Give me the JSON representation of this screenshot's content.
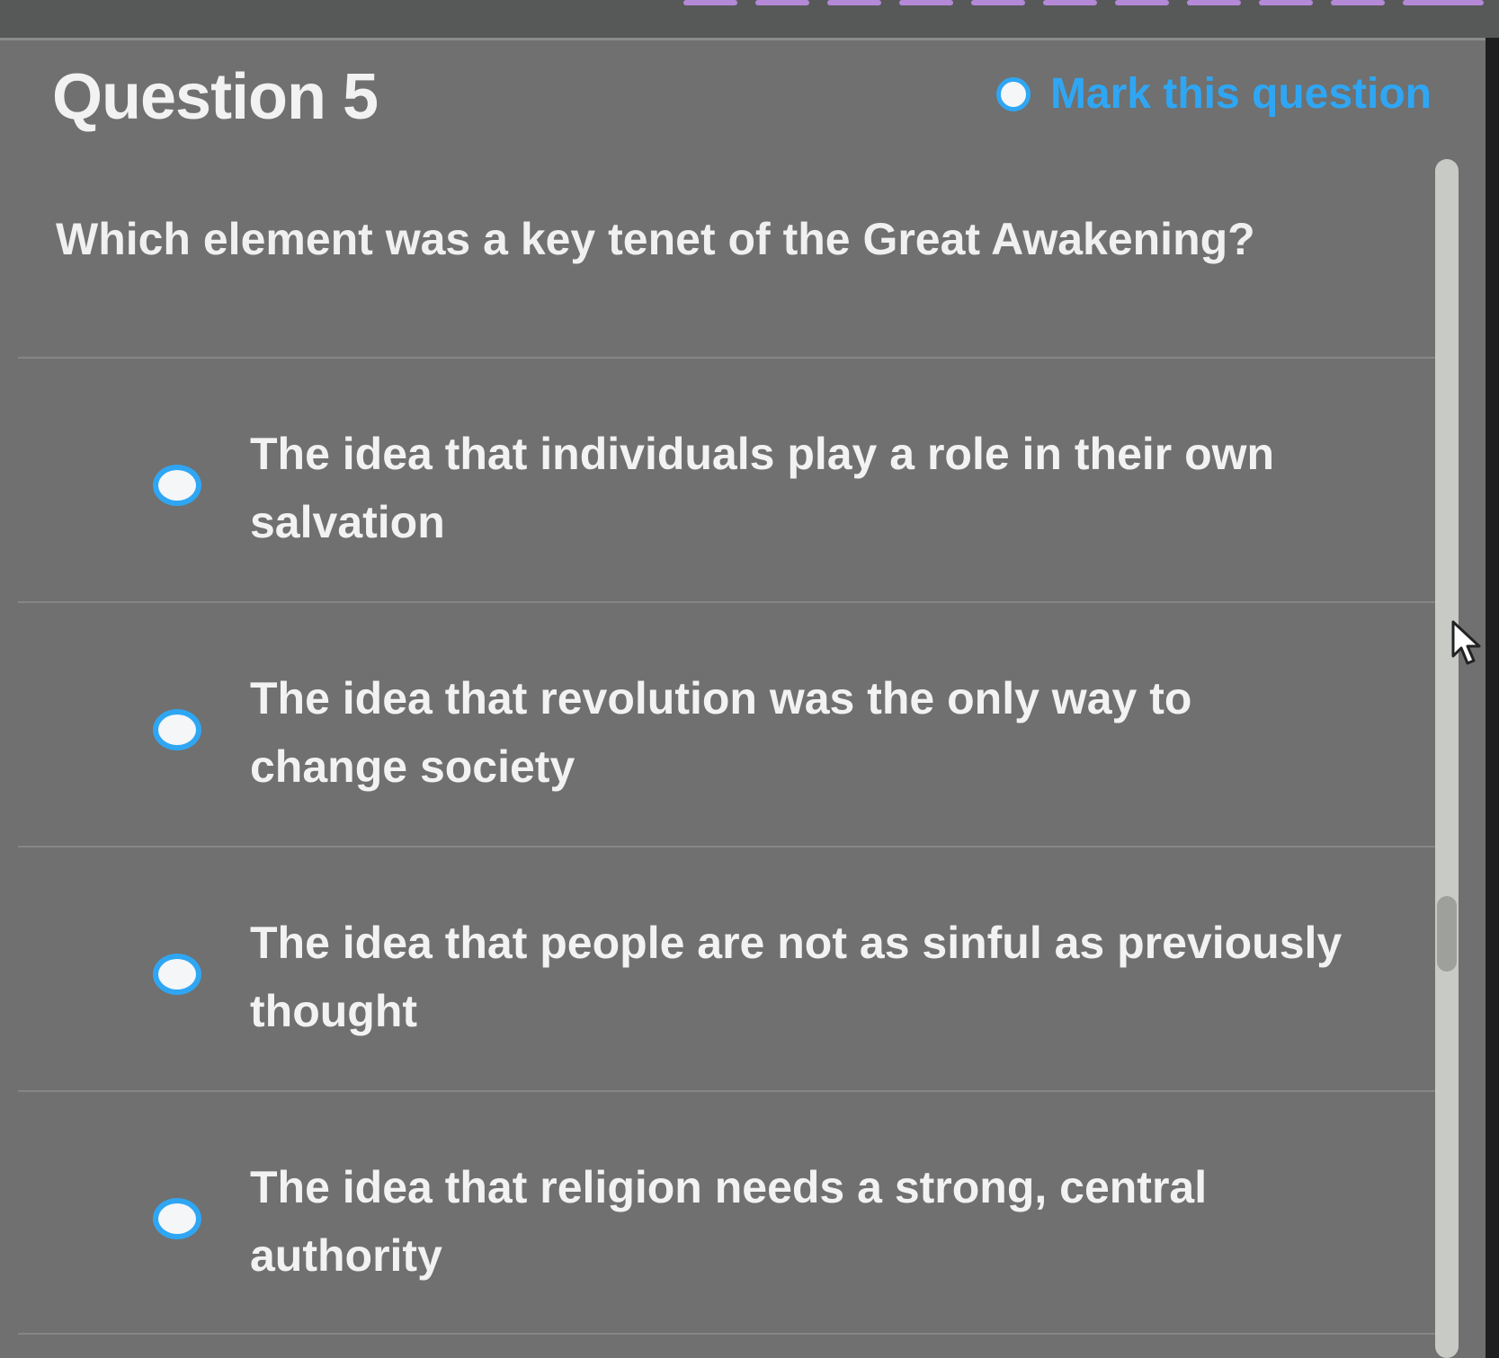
{
  "header": {
    "title": "Question 5",
    "mark_label": "Mark this question"
  },
  "question": {
    "prompt": "Which element was a key tenet of the Great Awakening?"
  },
  "options": [
    {
      "text": "The idea that individuals play a role in their own salvation"
    },
    {
      "text": "The idea that revolution was the only way to change society"
    },
    {
      "text": "The idea that people are not as sinful as previously thought"
    },
    {
      "text": "The idea that religion needs a strong, central authority"
    }
  ],
  "colors": {
    "accent": "#2fa6f4",
    "panel": "#6f706f",
    "progress": "#b48ad8"
  },
  "icons": {
    "radio": "radio-unselected-icon",
    "cursor": "mouse-cursor-icon"
  }
}
